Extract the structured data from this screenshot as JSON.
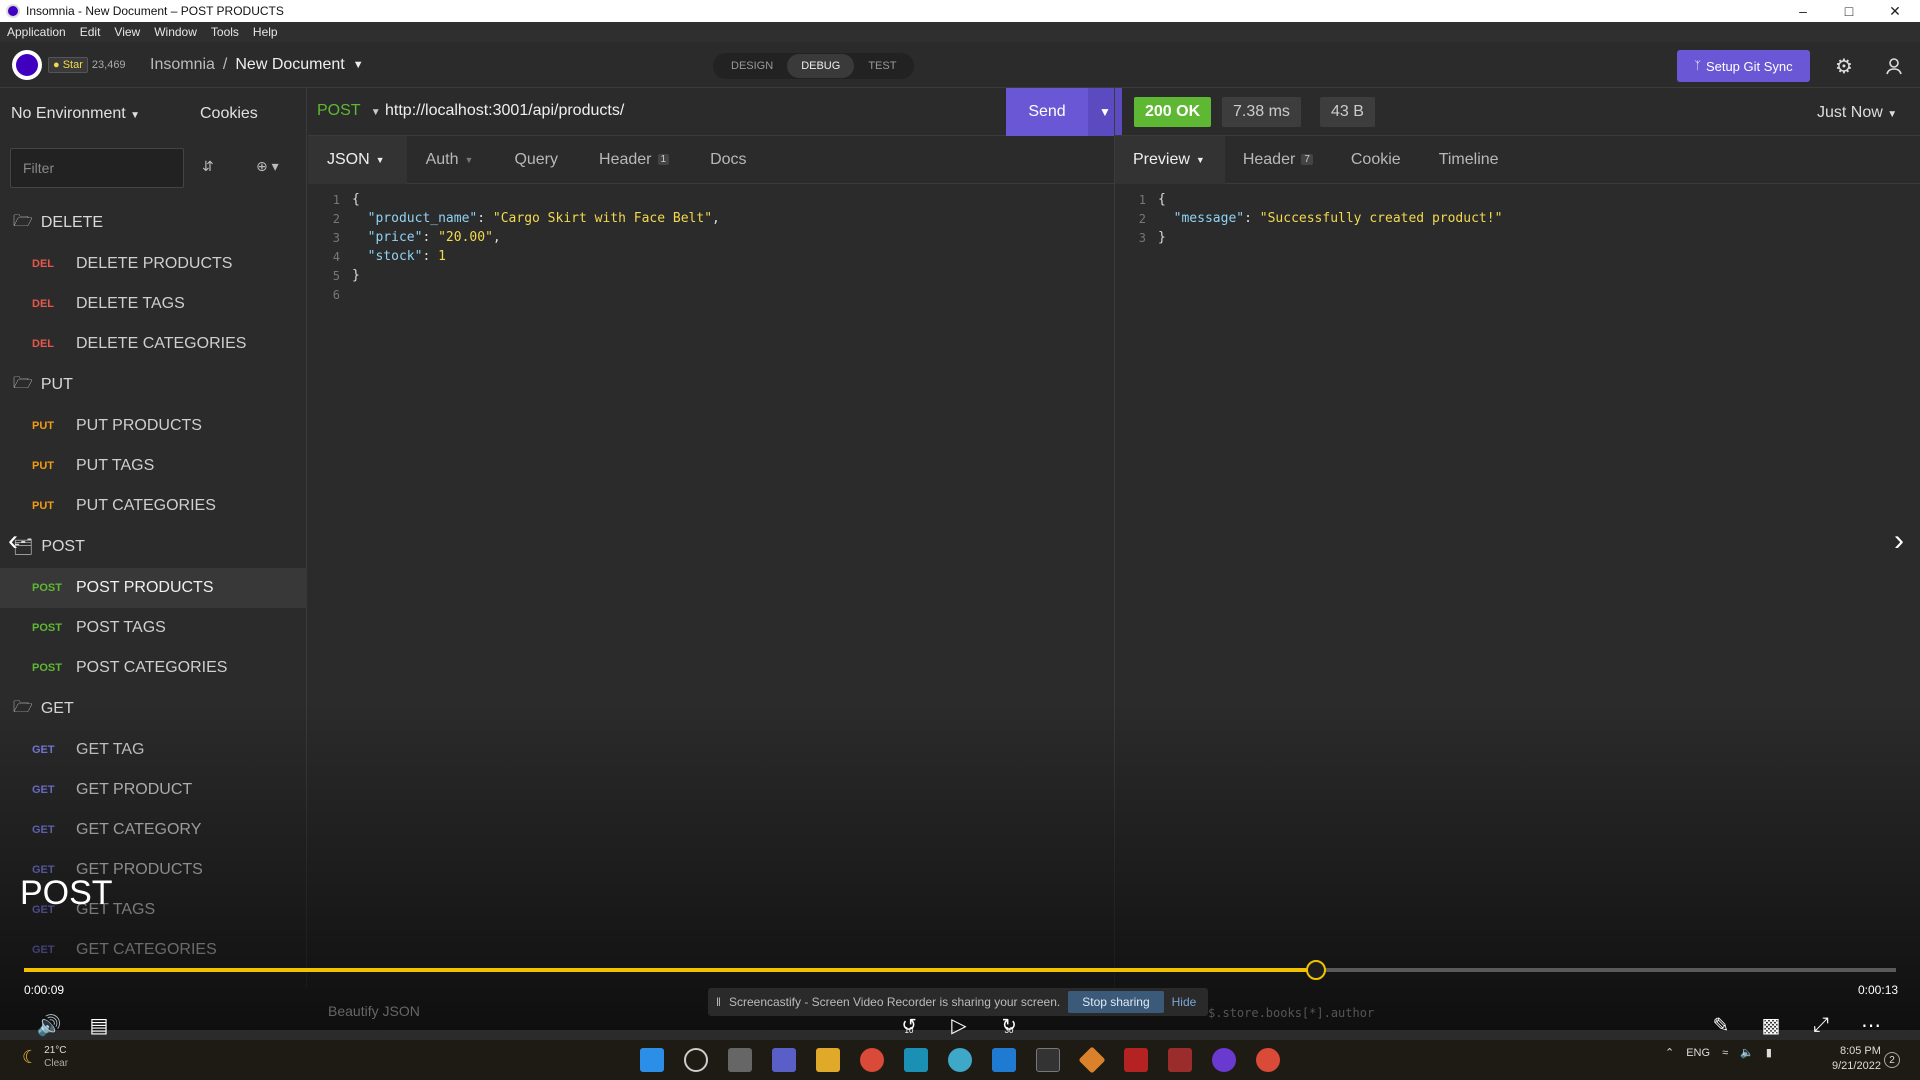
{
  "window": {
    "title": "Insomnia - New Document – POST PRODUCTS",
    "minimize": "–",
    "maximize": "□",
    "close": "✕"
  },
  "menubar": [
    "Application",
    "Edit",
    "View",
    "Window",
    "Tools",
    "Help"
  ],
  "header": {
    "star_label": "Star",
    "star_count": "23,469",
    "breadcrumb_root": "Insomnia",
    "breadcrumb_sep": "/",
    "breadcrumb_current": "New Document",
    "modes": [
      "DESIGN",
      "DEBUG",
      "TEST"
    ],
    "active_mode": "DEBUG",
    "git_sync_label": "Setup Git Sync"
  },
  "sidebar": {
    "environment": "No Environment",
    "cookies": "Cookies",
    "filter_placeholder": "Filter",
    "folders": [
      {
        "name": "DELETE",
        "items": [
          {
            "method": "DEL",
            "name": "DELETE PRODUCTS"
          },
          {
            "method": "DEL",
            "name": "DELETE TAGS"
          },
          {
            "method": "DEL",
            "name": "DELETE CATEGORIES"
          }
        ]
      },
      {
        "name": "PUT",
        "items": [
          {
            "method": "PUT",
            "name": "PUT PRODUCTS"
          },
          {
            "method": "PUT",
            "name": "PUT TAGS"
          },
          {
            "method": "PUT",
            "name": "PUT CATEGORIES"
          }
        ]
      },
      {
        "name": "POST",
        "items": [
          {
            "method": "POST",
            "name": "POST PRODUCTS"
          },
          {
            "method": "POST",
            "name": "POST TAGS"
          },
          {
            "method": "POST",
            "name": "POST CATEGORIES"
          }
        ]
      },
      {
        "name": "GET",
        "items": [
          {
            "method": "GET",
            "name": "GET TAG"
          },
          {
            "method": "GET",
            "name": "GET PRODUCT"
          },
          {
            "method": "GET",
            "name": "GET CATEGORY"
          },
          {
            "method": "GET",
            "name": "GET PRODUCTS"
          },
          {
            "method": "GET",
            "name": "GET TAGS"
          },
          {
            "method": "GET",
            "name": "GET CATEGORIES"
          }
        ]
      }
    ],
    "active_item": "POST PRODUCTS"
  },
  "request": {
    "method": "POST",
    "url": "http://localhost:3001/api/products/",
    "send_label": "Send",
    "tabs": [
      {
        "label": "JSON",
        "dropdown": true,
        "active": true
      },
      {
        "label": "Auth",
        "dropdown": true
      },
      {
        "label": "Query"
      },
      {
        "label": "Header",
        "badge": "1"
      },
      {
        "label": "Docs"
      }
    ],
    "body_lines": [
      {
        "n": "1",
        "text": "{"
      },
      {
        "n": "2",
        "key": "\"product_name\"",
        "val": "\"Cargo Skirt with Face Belt\"",
        "end": ","
      },
      {
        "n": "3",
        "key": "\"price\"",
        "val": "\"20.00\"",
        "end": ","
      },
      {
        "n": "4",
        "key": "\"stock\"",
        "val": "1",
        "end": ""
      },
      {
        "n": "5",
        "text": "}"
      },
      {
        "n": "6",
        "text": ""
      }
    ],
    "beautify_label": "Beautify JSON"
  },
  "response": {
    "status": "200 OK",
    "time": "7.38 ms",
    "size": "43 B",
    "history": "Just Now",
    "tabs": [
      {
        "label": "Preview",
        "dropdown": true,
        "active": true
      },
      {
        "label": "Header",
        "badge": "7"
      },
      {
        "label": "Cookie"
      },
      {
        "label": "Timeline"
      }
    ],
    "body_lines": [
      {
        "n": "1",
        "text": "{"
      },
      {
        "n": "2",
        "key": "\"message\"",
        "val": "\"Successfully created product!\"",
        "end": ""
      },
      {
        "n": "3",
        "text": "}"
      }
    ],
    "filter_hint": "$.store.books[*].author"
  },
  "player": {
    "caption": "POST",
    "time_current": "0:00:09",
    "time_total": "0:00:13",
    "progress": 0.69,
    "rewind_label": "10",
    "forward_label": "30",
    "share_text": "Screencastify - Screen Video Recorder is sharing your screen.",
    "stop_label": "Stop sharing",
    "hide_label": "Hide"
  },
  "taskbar": {
    "temperature": "21°C",
    "weather": "Clear",
    "lang": "ENG",
    "time": "8:05 PM",
    "date": "9/21/2022",
    "notifications": "2"
  }
}
